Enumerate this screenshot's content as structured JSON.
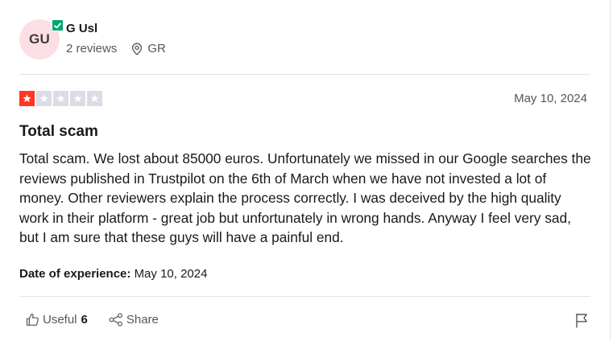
{
  "reviewer": {
    "initials": "GU",
    "name": "G Usl",
    "reviews_count": "2 reviews",
    "location": "GR",
    "verified": true,
    "avatar_color": "#fcdfe5",
    "badge_color": "#04a76e"
  },
  "review": {
    "rating": 1,
    "max_rating": 5,
    "star_fill_color": "#ff3722",
    "star_empty_color": "#dcdce6",
    "date": "May 10, 2024",
    "title": "Total scam",
    "text": "Total scam. We lost about 85000 euros. Unfortunately we missed in our Google searches the reviews published in Trustpilot on the 6th of March when we have not invested a lot of money. Other reviewers explain the process correctly. I was deceived by the high quality work in their platform - great job but unfortunately in wrong hands. Anyway I feel very sad, but I am sure that these guys will have a painful end.",
    "experience_label": "Date of experience:",
    "experience_date": "May 10, 2024"
  },
  "actions": {
    "useful_label": "Useful",
    "useful_count": "6",
    "share_label": "Share",
    "icons": [
      "thumbs-up-icon",
      "share-icon",
      "flag-icon"
    ]
  }
}
